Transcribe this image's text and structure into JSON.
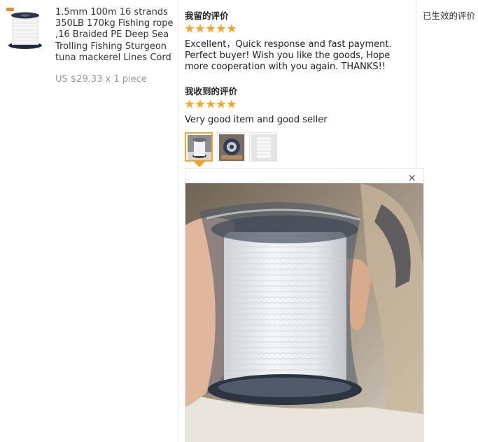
{
  "product": {
    "title": "1.5mm 100m 16 strands 350LB 170kg Fishing rope ,16 Braided PE Deep Sea Trolling Fishing Sturgeon tuna mackerel Lines Cord",
    "price": "US $29.33 x 1 piece",
    "thumb_icon": "spool-icon"
  },
  "my_review": {
    "heading": "我留的评价",
    "rating": 5,
    "text": "Excellent，Quick response and fast payment. Perfect buyer! Wish you like the goods, Hope more cooperation with you again. THANKS!!"
  },
  "received_review": {
    "heading": "我收到的评价",
    "rating": 5,
    "text": "Very good item and good seller"
  },
  "photos": {
    "selected_index": 0,
    "thumbnails": [
      "photo-1",
      "photo-2",
      "photo-3"
    ],
    "close_label": "×"
  },
  "status": {
    "label": "已生效的评价"
  },
  "colors": {
    "star": "#f5a623",
    "price": "#999999",
    "border": "#e8e8e8"
  }
}
